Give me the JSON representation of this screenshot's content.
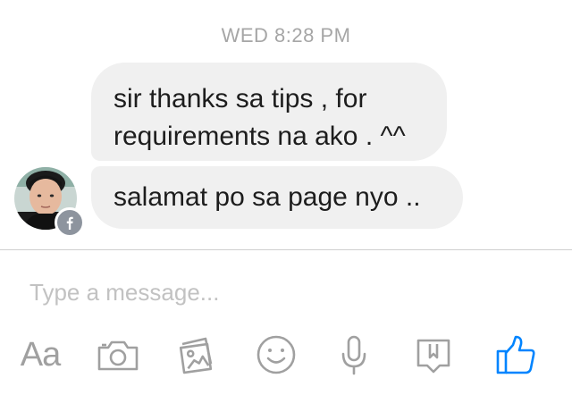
{
  "conversation": {
    "timestamp": "WED 8:28 PM",
    "messages": [
      {
        "lines": [
          "sir thanks sa tips , for",
          "requirements na ako . ^^"
        ]
      },
      {
        "lines": [
          "salamat po sa page nyo .."
        ]
      }
    ]
  },
  "composer": {
    "placeholder": "Type a message..."
  },
  "toolbar": {
    "text_style_label": "Aa",
    "icons": [
      "text-style-icon",
      "camera-icon",
      "gallery-icon",
      "emoji-icon",
      "microphone-icon",
      "bookmark-icon",
      "like-thumbs-up-icon"
    ]
  },
  "colors": {
    "bubble": "#f0f0f0",
    "timestamp": "#a6a6a6",
    "icon_gray": "#a0a0a0",
    "like_blue": "#0084ff"
  }
}
